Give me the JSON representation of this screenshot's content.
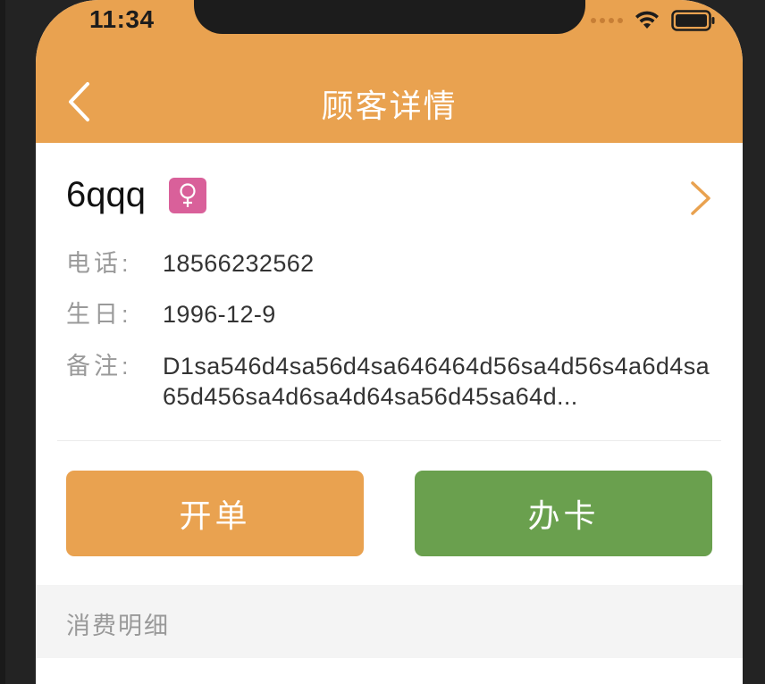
{
  "status_bar": {
    "time": "11:34"
  },
  "nav": {
    "title": "顾客详情",
    "back_icon": "chevron-left-icon"
  },
  "customer": {
    "name": "6qqq",
    "gender_icon": "female-icon",
    "rows": [
      {
        "label": "电话:",
        "value": "18566232562"
      },
      {
        "label": "生日:",
        "value": "1996-12-9"
      },
      {
        "label": "备注:",
        "value": "D1sa546d4sa56d4sa646464d56sa4d56s4a6d4sa65d456sa4d6sa4d64sa56d45sa64d..."
      }
    ]
  },
  "actions": {
    "order_label": "开单",
    "card_label": "办卡"
  },
  "section": {
    "title": "消费明细"
  },
  "colors": {
    "brand_orange": "#e9a250",
    "action_green": "#6aa04e",
    "female_pink": "#d9609a"
  }
}
